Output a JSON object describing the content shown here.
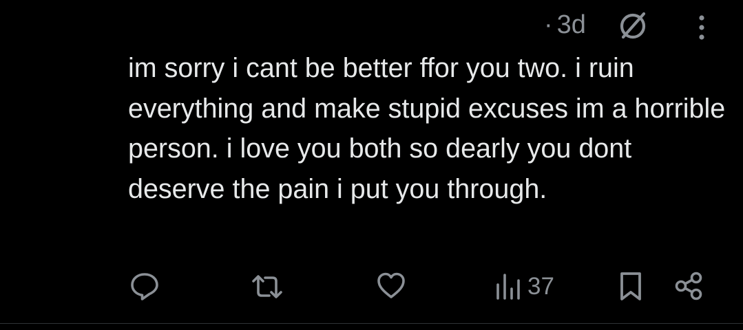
{
  "post": {
    "time_separator": "·",
    "time": "3d",
    "icons": {
      "blocked": "no-entry-icon",
      "more": "more-vertical-icon"
    },
    "text": "im sorry i cant be better ffor you two. i ruin everything and make stupid excuses im a horrible person. i love you both so dearly you dont deserve the pain i put you through.",
    "actions": {
      "reply_icon": "reply-icon",
      "repost_icon": "repost-icon",
      "like_icon": "heart-icon",
      "views_icon": "views-chart-icon",
      "views_count": "37",
      "bookmark_icon": "bookmark-icon",
      "share_icon": "share-icon"
    }
  },
  "colors": {
    "background": "#000000",
    "text": "#e7e9ea",
    "secondary": "#8b9096",
    "divider": "#2f3336"
  }
}
